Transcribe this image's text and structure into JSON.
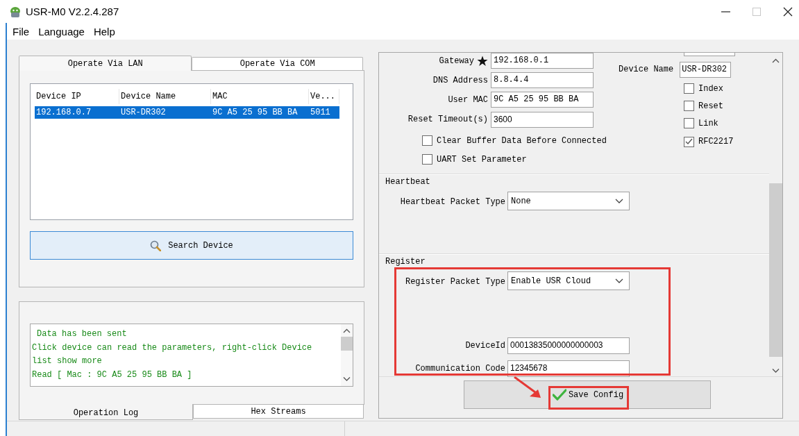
{
  "window": {
    "title": "USR-M0 V2.2.4.287"
  },
  "menu": [
    "File",
    "Language",
    "Help"
  ],
  "device_tabs": [
    {
      "label": "Operate Via LAN",
      "selected": true
    },
    {
      "label": "Operate Via COM",
      "selected": false
    }
  ],
  "device_table": {
    "columns": [
      "Device IP",
      "Device Name",
      "MAC",
      "Ve..."
    ],
    "rows": [
      {
        "cells": [
          "192.168.0.7",
          "USR-DR302",
          "9C A5 25 95 BB BA",
          "5011"
        ],
        "selected": true
      }
    ]
  },
  "search_button": "Search Device",
  "log": [
    "Data has been sent",
    "Click device can read the parameters, right-click Device list show more",
    "Read [ Mac : 9C A5 25 95 BB BA ]"
  ],
  "log_tabs": [
    {
      "label": "Operation Log",
      "selected": true
    },
    {
      "label": "Hex Streams",
      "selected": false
    }
  ],
  "network": [
    {
      "label": "Gateway",
      "required": true,
      "value": "192.168.0.1"
    },
    {
      "label": "DNS Address",
      "required": false,
      "value": "8.8.4.4"
    },
    {
      "label": "User MAC",
      "required": false,
      "value": "9C A5 25 95 BB BA"
    },
    {
      "label": "Reset Timeout(s)",
      "required": false,
      "value": "3600"
    }
  ],
  "options": [
    {
      "label": "Clear Buffer Data Before Connected",
      "checked": false
    },
    {
      "label": "UART Set Parameter",
      "checked": false
    }
  ],
  "device_name": {
    "label": "Device Name",
    "value": "USR-DR302"
  },
  "flags": [
    {
      "label": "Index",
      "checked": false
    },
    {
      "label": "Reset",
      "checked": false
    },
    {
      "label": "Link",
      "checked": false
    },
    {
      "label": "RFC2217",
      "checked": true
    }
  ],
  "groups": [
    {
      "title": "Heartbeat",
      "fields": [
        {
          "kind": "select",
          "label": "Heartbeat Packet Type",
          "value": "None"
        }
      ]
    },
    {
      "title": "Register",
      "fields": [
        {
          "kind": "select",
          "label": "Register Packet Type",
          "value": "Enable USR Cloud"
        },
        {
          "kind": "text",
          "label": "DeviceId",
          "value": "00013835000000000003"
        },
        {
          "kind": "text",
          "label": "Communication Code",
          "value": "12345678"
        }
      ]
    }
  ],
  "save_button": "Save Config"
}
